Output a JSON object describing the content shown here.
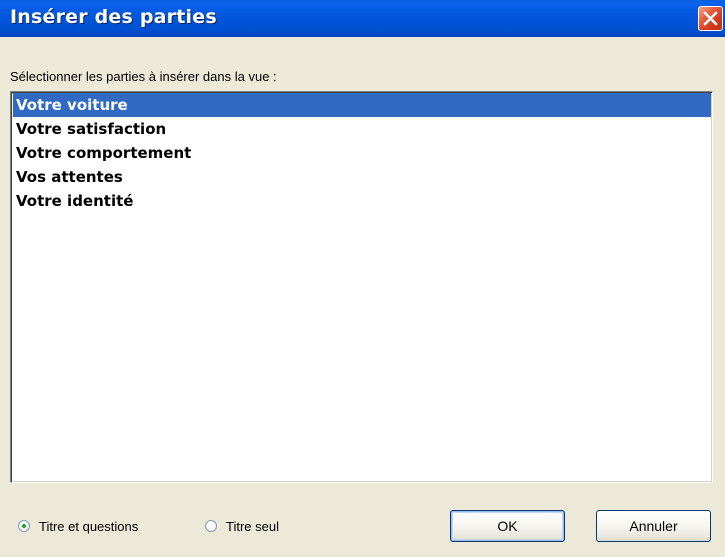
{
  "window": {
    "title": "Insérer des parties",
    "close_icon": "close-icon"
  },
  "prompt": "Sélectionner les parties à insérer dans la vue :",
  "parts": {
    "items": [
      {
        "label": "Votre voiture",
        "selected": true
      },
      {
        "label": "Votre satisfaction",
        "selected": false
      },
      {
        "label": "Votre comportement",
        "selected": false
      },
      {
        "label": "Vos attentes",
        "selected": false
      },
      {
        "label": "Votre identité",
        "selected": false
      }
    ]
  },
  "options": {
    "title_and_questions": {
      "label": "Titre et questions",
      "checked": true
    },
    "title_only": {
      "label": "Titre seul",
      "checked": false
    }
  },
  "buttons": {
    "ok": "OK",
    "cancel": "Annuler"
  },
  "colors": {
    "titlebar": "#0453DA",
    "selection": "#316AC5",
    "dialog_bg": "#ECE9D8",
    "close_button": "#D2381B"
  }
}
